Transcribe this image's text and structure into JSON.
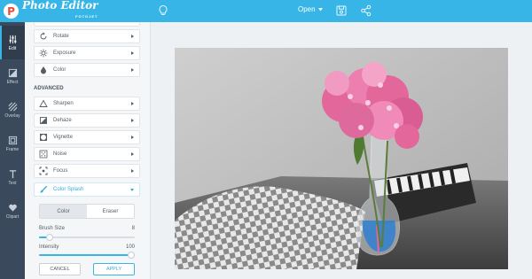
{
  "app": {
    "logo_letter": "P",
    "logo_title": "Photo Editor",
    "logo_subtitle": "FOTOJET"
  },
  "header": {
    "open_label": "Open"
  },
  "rail": [
    {
      "label": "Edit",
      "icon": "sliders-icon",
      "active": true
    },
    {
      "label": "Effect",
      "icon": "effect-icon"
    },
    {
      "label": "Overlay",
      "icon": "overlay-icon"
    },
    {
      "label": "Frame",
      "icon": "frame-icon"
    },
    {
      "label": "Text",
      "icon": "text-icon"
    },
    {
      "label": "Clipart",
      "icon": "heart-icon"
    }
  ],
  "panel": {
    "basic_tools": [
      {
        "label": "Rotate",
        "icon": "rotate-icon"
      },
      {
        "label": "Exposure",
        "icon": "sun-icon"
      },
      {
        "label": "Color",
        "icon": "drop-icon"
      }
    ],
    "advanced_title": "ADVANCED",
    "advanced_tools": [
      {
        "label": "Sharpen",
        "icon": "triangle-icon"
      },
      {
        "label": "Dehaze",
        "icon": "dehaze-icon"
      },
      {
        "label": "Vignette",
        "icon": "vignette-icon"
      },
      {
        "label": "Noise",
        "icon": "noise-icon"
      },
      {
        "label": "Focus",
        "icon": "focus-icon"
      },
      {
        "label": "Color Splash",
        "icon": "brush-icon",
        "active": true
      }
    ],
    "color_splash": {
      "mode_color": "Color",
      "mode_eraser": "Eraser",
      "brush_size_label": "Brush Size",
      "brush_size_value": "8",
      "brush_size_fraction": 0.08,
      "intensity_label": "Intensity",
      "intensity_value": "100",
      "intensity_fraction": 1.0,
      "cancel_label": "CANCEL",
      "apply_label": "APPLY"
    }
  },
  "colors": {
    "accent": "#37b5e6",
    "rail_bg": "#3a4a5c",
    "flower_pink": "#e3679b",
    "vase_blue": "#2f7fd0"
  }
}
